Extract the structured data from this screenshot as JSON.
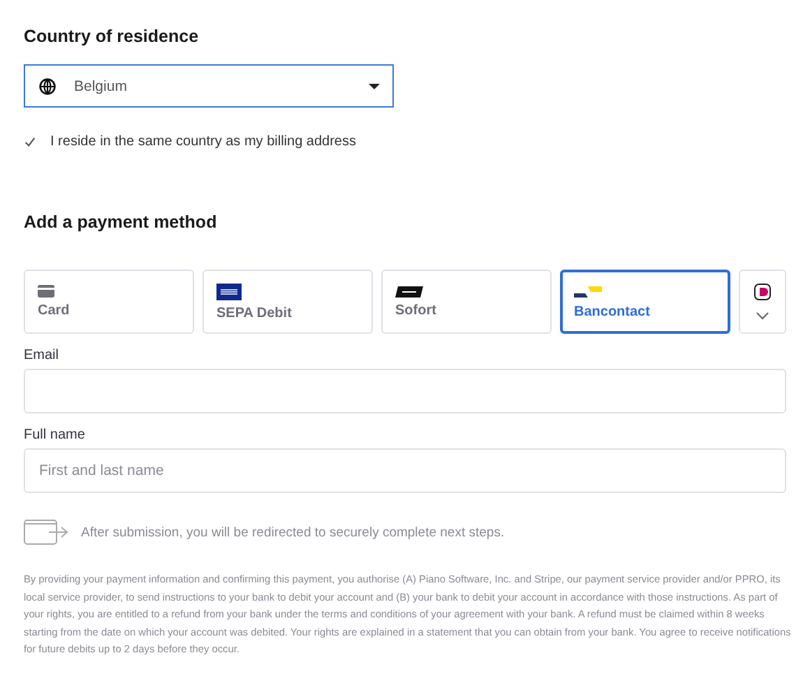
{
  "country": {
    "heading": "Country of residence",
    "value": "Belgium"
  },
  "same_country": {
    "label": "I reside in the same country as my billing address",
    "checked": true
  },
  "payment": {
    "heading": "Add a payment method",
    "methods": [
      {
        "kind": "card",
        "label": "Card",
        "selected": false
      },
      {
        "kind": "sepa",
        "label": "SEPA Debit",
        "selected": false
      },
      {
        "kind": "sofort",
        "label": "Sofort",
        "selected": false
      },
      {
        "kind": "bancontact",
        "label": "Bancontact",
        "selected": true
      },
      {
        "kind": "more",
        "selected": false
      }
    ]
  },
  "fields": [
    {
      "label": "Email"
    },
    {
      "label": "Full name",
      "placeholder": "First and last name"
    }
  ],
  "redirect_note": "After submission, you will be redirected to securely complete next steps.",
  "legal": "By providing your payment information and confirming this payment, you authorise (A) Piano Software, Inc. and Stripe, our payment service provider and/or PPRO, its local service provider, to send instructions to your bank to debit your account and (B) your bank to debit your account in accordance with those instructions. As part of your rights, you are entitled to a refund from your bank under the terms and conditions of your agreement with your bank. A refund must be claimed within 8 weeks starting from the date on which your account was debited. Your rights are explained in a statement that you can obtain from your bank. You agree to receive notifications for future debits up to 2 days before they occur."
}
